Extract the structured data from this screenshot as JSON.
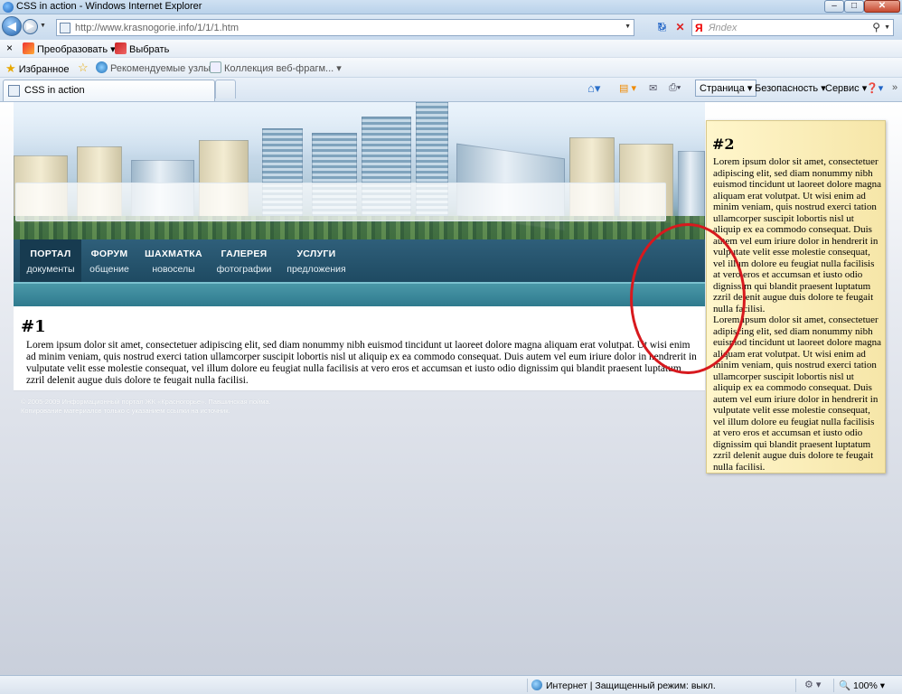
{
  "window": {
    "title": "CSS in action - Windows Internet Explorer",
    "min_glyph": "–",
    "max_glyph": "□",
    "close_glyph": "✕"
  },
  "address": {
    "url": "http://www.krasnogorie.info/1/1/1.htm",
    "search_placeholder": "Яndex",
    "yandex_glyph": "Я"
  },
  "toolbar1": {
    "close_glyph": "×",
    "convert_label": "Преобразовать",
    "select_label": "Выбрать"
  },
  "favorites": {
    "favorites_label": "Избранное",
    "suggested_label": "Рекомендуемые узлы",
    "gallery_label": "Коллекция веб-фрагм..."
  },
  "tabs": {
    "active_label": "CSS in action"
  },
  "commands": {
    "page_label": "Страница",
    "safety_label": "Безопасность",
    "tools_label": "Сервис"
  },
  "nav": [
    {
      "title": "ПОРТАЛ",
      "sub": "документы",
      "active": true
    },
    {
      "title": "ФОРУМ",
      "sub": "общение"
    },
    {
      "title": "ШАХМАТКА",
      "sub": "новоселы"
    },
    {
      "title": "ГАЛЕРЕЯ",
      "sub": "фотографии"
    },
    {
      "title": "УСЛУГИ",
      "sub": "предложения"
    }
  ],
  "content1": {
    "heading": "#1",
    "text": "Lorem ipsum dolor sit amet, consectetuer adipiscing elit, sed diam nonummy nibh euismod tincidunt ut laoreet dolore magna aliquam erat volutpat. Ut wisi enim ad minim veniam, quis nostrud exerci tation ullamcorper suscipit lobortis nisl ut aliquip ex ea commodo consequat. Duis autem vel eum iriure dolor in hendrerit in vulputate velit esse molestie consequat, vel illum dolore eu feugiat nulla facilisis at vero eros et accumsan et iusto odio dignissim qui blandit praesent luptatum zzril delenit augue duis dolore te feugait nulla facilisi."
  },
  "footer": {
    "line1": "© 2005-2009 Информационный портал ЖК «Красногорье». Павшинская пойма.",
    "line2": "Копирование материалов только с указанием ссылки на источник."
  },
  "float2": {
    "heading": "#2",
    "para1": "Lorem ipsum dolor sit amet, consectetuer adipiscing elit, sed diam nonummy nibh euismod tincidunt ut laoreet dolore magna aliquam erat volutpat. Ut wisi enim ad minim veniam, quis nostrud exerci tation ullamcorper suscipit lobortis nisl ut aliquip ex ea commodo consequat. Duis autem vel eum iriure dolor in hendrerit in vulputate velit esse molestie consequat, vel illum dolore eu feugiat nulla facilisis at vero eros et accumsan et iusto odio dignissim qui blandit praesent luptatum zzril delenit augue duis dolore te feugait nulla facilisi.",
    "para2": "Lorem ipsum dolor sit amet, consectetuer adipiscing elit, sed diam nonummy nibh euismod tincidunt ut laoreet dolore magna aliquam erat volutpat. Ut wisi enim ad minim veniam, quis nostrud exerci tation ullamcorper suscipit lobortis nisl ut aliquip ex ea commodo consequat. Duis autem vel eum iriure dolor in hendrerit in vulputate velit esse molestie consequat, vel illum dolore eu feugiat nulla facilisis at vero eros et accumsan et iusto odio dignissim qui blandit praesent luptatum zzril delenit augue duis dolore te feugait nulla facilisi."
  },
  "status": {
    "zone": "Интернет | Защищенный режим: выкл.",
    "zoom": "100%"
  },
  "colors": {
    "nav_bg": "#1e4a62",
    "subbar": "#2f7a8e",
    "note_bg": "#fff6cc",
    "annotation": "#d7191e"
  }
}
